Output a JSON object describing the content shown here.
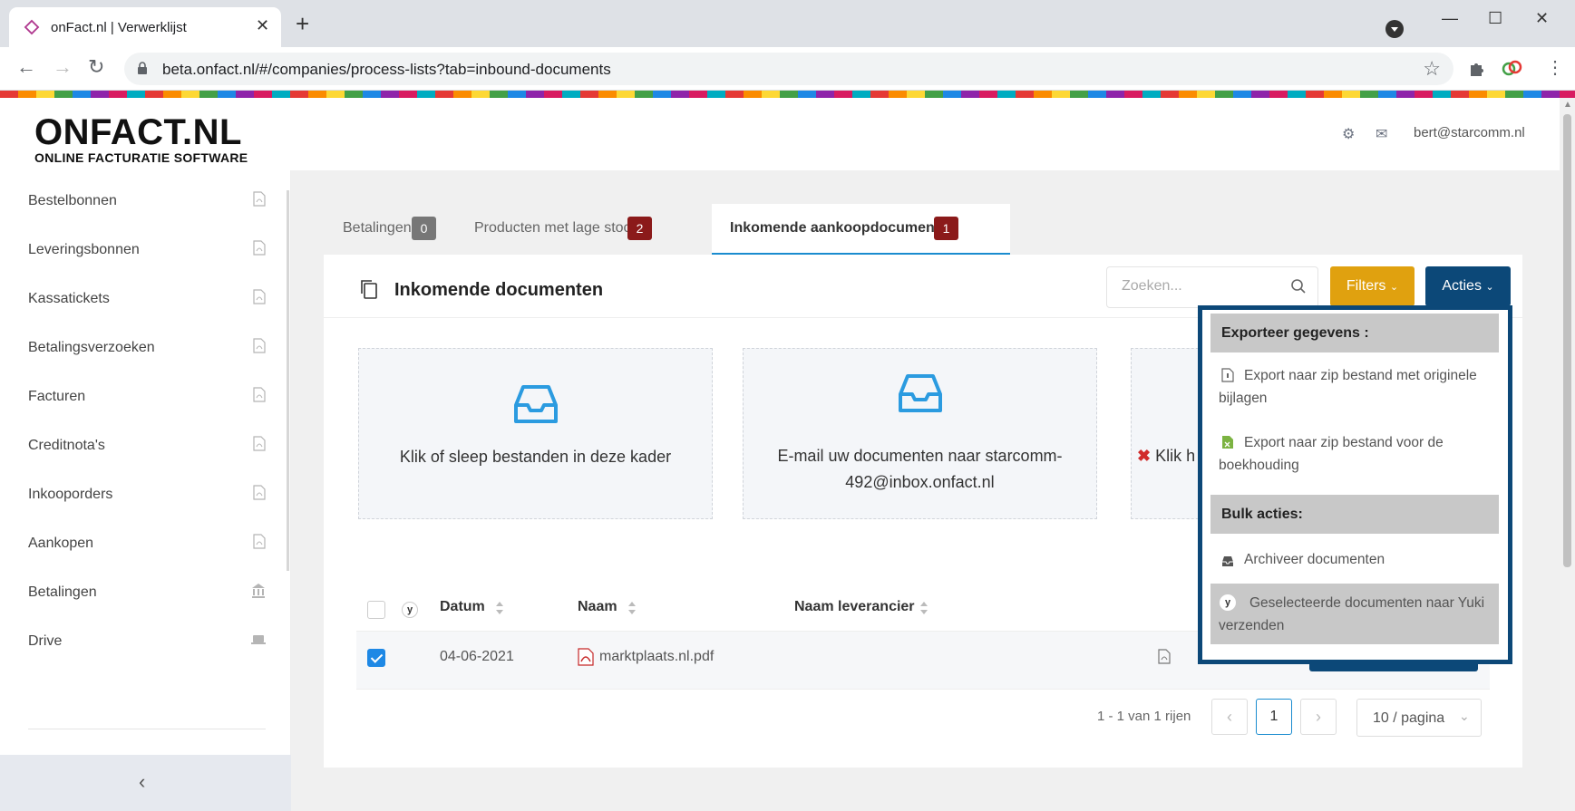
{
  "browser": {
    "tab_title": "onFact.nl | Verwerklijst",
    "url": "beta.onfact.nl/#/companies/process-lists?tab=inbound-documents"
  },
  "header": {
    "logo_main": "ONFACT.NL",
    "logo_sub": "ONLINE FACTURATIE SOFTWARE",
    "user_email": "bert@starcomm.nl"
  },
  "sidebar": {
    "items": [
      {
        "label": "Bestelbonnen",
        "icon": "pdf-file-icon"
      },
      {
        "label": "Leveringsbonnen",
        "icon": "pdf-file-icon"
      },
      {
        "label": "Kassatickets",
        "icon": "pdf-file-icon"
      },
      {
        "label": "Betalingsverzoeken",
        "icon": "pdf-file-icon"
      },
      {
        "label": "Facturen",
        "icon": "pdf-file-icon"
      },
      {
        "label": "Creditnota's",
        "icon": "pdf-file-icon"
      },
      {
        "label": "Inkooporders",
        "icon": "pdf-file-icon"
      },
      {
        "label": "Aankopen",
        "icon": "pdf-file-icon"
      },
      {
        "label": "Betalingen",
        "icon": "bank-icon"
      },
      {
        "label": "Drive",
        "icon": "drive-icon"
      }
    ]
  },
  "tabs": [
    {
      "label": "Betalingen",
      "count": "0",
      "badge_color": "#777777"
    },
    {
      "label": "Producten met lage stock",
      "count": "2",
      "badge_color": "#8b1a1a"
    },
    {
      "label": "Inkomende aankoopdocumenten",
      "count": "1",
      "badge_color": "#8b1a1a"
    }
  ],
  "card": {
    "title": "Inkomende documenten",
    "search_placeholder": "Zoeken...",
    "filters_label": "Filters",
    "acties_label": "Acties"
  },
  "dropzones": {
    "upload_text": "Klik of sleep bestanden in deze kader",
    "email_text": "E-mail uw documenten naar starcomm-492@inbox.onfact.nl",
    "third_text": "Klik h"
  },
  "table": {
    "columns": {
      "date": "Datum",
      "name": "Naam",
      "supplier": "Naam leverancier"
    },
    "yuki_mark": "y",
    "rows": [
      {
        "date": "04-06-2021",
        "name": "marktplaats.nl.pdf",
        "supplier": "",
        "checked": true
      }
    ]
  },
  "pagination": {
    "summary": "1 - 1 van 1 rijen",
    "current_page": "1",
    "page_size": "10 / pagina"
  },
  "dropdown": {
    "export_header": "Exporteer gegevens :",
    "export_items": [
      "Export naar zip bestand met originele bijlagen",
      "Export naar zip bestand voor de boekhouding"
    ],
    "bulk_header": "Bulk acties:",
    "bulk_items": [
      "Archiveer documenten",
      "Geselecteerde documenten naar Yuki verzenden"
    ]
  },
  "colors": {
    "primary": "#0c4878",
    "filters": "#e0a10f",
    "accent": "#1a8ccf",
    "inbox_icon": "#2b9be0",
    "badge_red": "#8b1a1a"
  }
}
